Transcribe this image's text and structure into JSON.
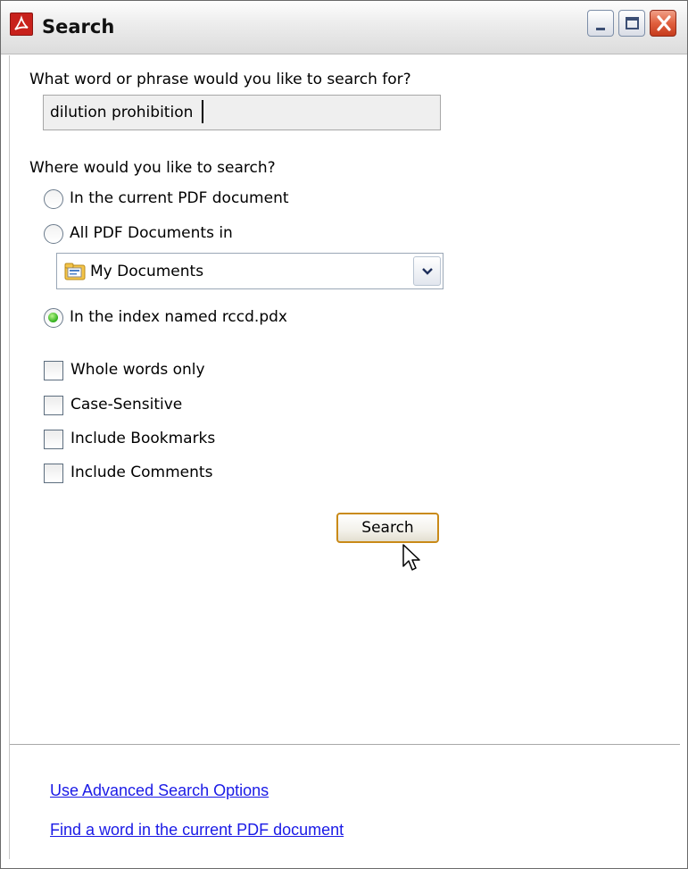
{
  "window": {
    "title": "Search",
    "icon": "adobe-reader-icon",
    "controls": [
      "minimize-icon",
      "maximize-icon",
      "close-icon"
    ],
    "close_color": "#e0603e"
  },
  "query": {
    "prompt": "What word or phrase would you like to search for?",
    "value": "dilution prohibition"
  },
  "location": {
    "prompt": "Where would you like to search?",
    "options": [
      {
        "label": "In the current PDF document",
        "selected": false
      },
      {
        "label": "All PDF Documents in",
        "selected": false
      },
      {
        "label": "In the index named rccd.pdx",
        "selected": true
      }
    ],
    "folder": {
      "value": "My Documents",
      "icon": "folder-icon"
    }
  },
  "options": {
    "checkboxes": [
      {
        "label": "Whole words only",
        "checked": false
      },
      {
        "label": "Case-Sensitive",
        "checked": false
      },
      {
        "label": "Include Bookmarks",
        "checked": false
      },
      {
        "label": "Include Comments",
        "checked": false
      }
    ]
  },
  "actions": {
    "search_label": "Search"
  },
  "links": {
    "advanced": "Use Advanced Search Options",
    "find_word": "Find a word in the current PDF document",
    "color": "#1a1ae6"
  }
}
